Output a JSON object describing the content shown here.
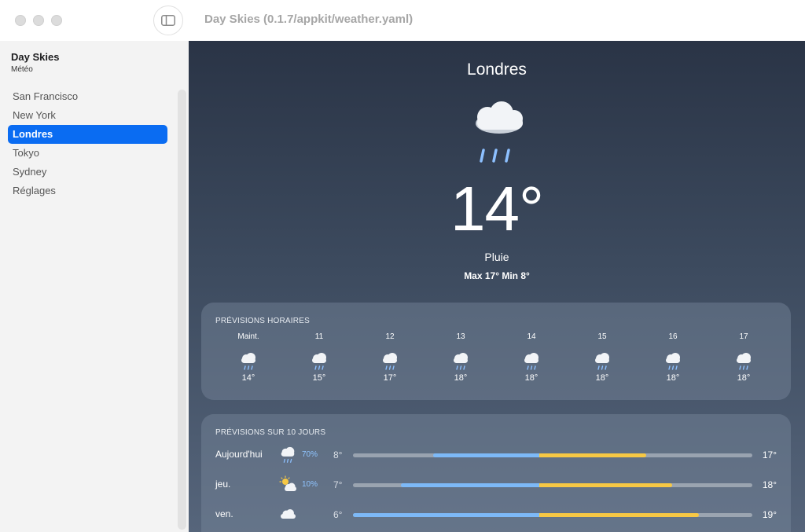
{
  "window": {
    "title": "Day Skies (0.1.7/appkit/weather.yaml)"
  },
  "sidebar": {
    "app_name": "Day Skies",
    "app_subtitle": "Météo",
    "items": [
      {
        "label": "San Francisco",
        "active": false
      },
      {
        "label": "New York",
        "active": false
      },
      {
        "label": "Londres",
        "active": true
      },
      {
        "label": "Tokyo",
        "active": false
      },
      {
        "label": "Sydney",
        "active": false
      },
      {
        "label": "Réglages",
        "active": false
      }
    ]
  },
  "current": {
    "city": "Londres",
    "icon": "cloud-rain-icon",
    "temperature": "14°",
    "condition": "Pluie",
    "hilo": "Max 17° Min 8°"
  },
  "hourly": {
    "title": "PRÉVISIONS HORAIRES",
    "items": [
      {
        "time": "Maint.",
        "icon": "cloud-rain-icon",
        "temp": "14°"
      },
      {
        "time": "11",
        "icon": "cloud-rain-icon",
        "temp": "15°"
      },
      {
        "time": "12",
        "icon": "cloud-rain-icon",
        "temp": "17°"
      },
      {
        "time": "13",
        "icon": "cloud-rain-icon",
        "temp": "18°"
      },
      {
        "time": "14",
        "icon": "cloud-rain-icon",
        "temp": "18°"
      },
      {
        "time": "15",
        "icon": "cloud-rain-icon",
        "temp": "18°"
      },
      {
        "time": "16",
        "icon": "cloud-rain-icon",
        "temp": "18°"
      },
      {
        "time": "17",
        "icon": "cloud-rain-icon",
        "temp": "18°"
      }
    ]
  },
  "daily": {
    "title": "PRÉVISIONS SUR 10 JOURS",
    "range_min": 5,
    "range_max": 20,
    "items": [
      {
        "day": "Aujourd'hui",
        "icon": "cloud-rain-icon",
        "precip": "70%",
        "low": "8°",
        "high": "17°",
        "low_value": 8,
        "mid_value": 12,
        "high_value": 16
      },
      {
        "day": "jeu.",
        "icon": "sun-cloud-icon",
        "precip": "10%",
        "low": "7°",
        "high": "18°",
        "low_value": 6.8,
        "mid_value": 12,
        "high_value": 17
      },
      {
        "day": "ven.",
        "icon": "cloud-icon",
        "precip": "",
        "low": "6°",
        "high": "19°",
        "low_value": 5,
        "mid_value": 12,
        "high_value": 18
      }
    ]
  },
  "colors": {
    "accent": "#0a6cf2",
    "bar_cool": "#7db9f7",
    "bar_warm": "#f7c844",
    "precip_text": "#8fc4ff"
  }
}
